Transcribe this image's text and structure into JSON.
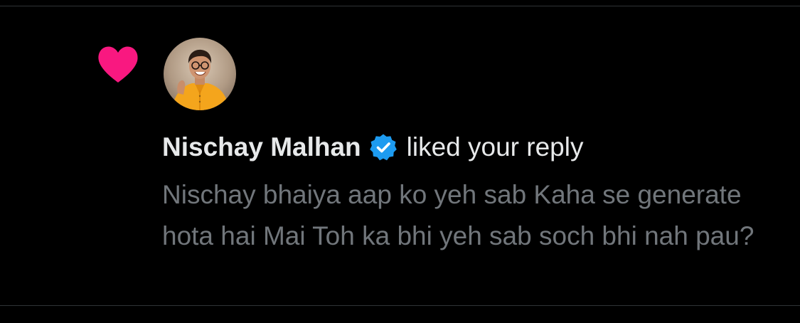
{
  "notification": {
    "type_icon": "heart-icon",
    "avatar_icon": "avatar",
    "user_name": "Nischay Malhan",
    "verified_icon": "verified-badge-icon",
    "action_text": "liked your reply",
    "reply_text": "Nischay bhaiya aap ko yeh sab Kaha se generate hota hai Mai Toh ka bhi yeh sab soch bhi nah pau?"
  },
  "colors": {
    "background": "#000000",
    "heart": "#f91880",
    "verified": "#1d9bf0",
    "primary_text": "#e7e9ea",
    "secondary_text": "#71767b",
    "divider": "#2f3336"
  }
}
